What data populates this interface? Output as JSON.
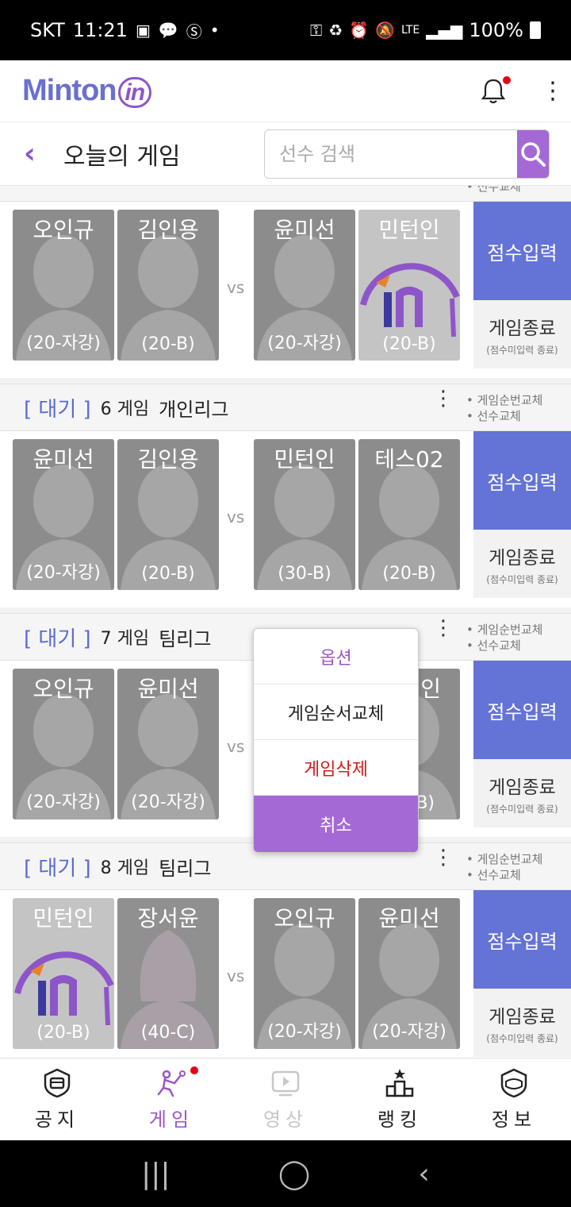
{
  "status_bar": {
    "carrier": "SKT",
    "time": "11:21",
    "network": "LTE",
    "battery": "100%"
  },
  "app": {
    "logo_main": "Minton",
    "logo_in": "in"
  },
  "header": {
    "title": "오늘의 게임",
    "search_placeholder": "선수 검색"
  },
  "games": [
    {
      "status": "",
      "number": "",
      "league": "",
      "notes": [
        "선수교체"
      ],
      "players": [
        {
          "name": "오인규",
          "grade": "(20-자강)",
          "avatar": "male"
        },
        {
          "name": "김인용",
          "grade": "(20-B)",
          "avatar": "male"
        },
        {
          "name": "윤미선",
          "grade": "(20-자강)",
          "avatar": "male"
        },
        {
          "name": "민턴인",
          "grade": "(20-B)",
          "avatar": "logo"
        }
      ]
    },
    {
      "status": "[ 대기 ]",
      "number": "6 게임",
      "league": "개인리그",
      "notes": [
        "게임순번교체",
        "선수교체"
      ],
      "players": [
        {
          "name": "윤미선",
          "grade": "(20-자강)",
          "avatar": "male"
        },
        {
          "name": "김인용",
          "grade": "(20-B)",
          "avatar": "male"
        },
        {
          "name": "민턴인",
          "grade": "(30-B)",
          "avatar": "male"
        },
        {
          "name": "테스02",
          "grade": "(20-B)",
          "avatar": "male"
        }
      ]
    },
    {
      "status": "[ 대기 ]",
      "number": "7 게임",
      "league": "팀리그",
      "notes": [
        "게임순번교체",
        "선수교체"
      ],
      "players": [
        {
          "name": "오인규",
          "grade": "(20-자강)",
          "avatar": "male"
        },
        {
          "name": "윤미선",
          "grade": "(20-자강)",
          "avatar": "male"
        },
        {
          "name": "",
          "grade": "",
          "avatar": "male"
        },
        {
          "name": "인",
          "grade": "B)",
          "avatar": "male"
        }
      ]
    },
    {
      "status": "[ 대기 ]",
      "number": "8 게임",
      "league": "팀리그",
      "notes": [
        "게임순번교체",
        "선수교체"
      ],
      "players": [
        {
          "name": "민턴인",
          "grade": "(20-B)",
          "avatar": "logo"
        },
        {
          "name": "장서윤",
          "grade": "(40-C)",
          "avatar": "female"
        },
        {
          "name": "오인규",
          "grade": "(20-자강)",
          "avatar": "male"
        },
        {
          "name": "윤미선",
          "grade": "(20-자강)",
          "avatar": "male"
        }
      ]
    }
  ],
  "game_labels": {
    "vs": "vs",
    "score_input": "점수입력",
    "end_game": "게임종료",
    "end_game_note": "(점수미입력 종료)"
  },
  "popup": {
    "title": "옵션",
    "reorder": "게임순서교체",
    "delete": "게임삭제",
    "cancel": "취소"
  },
  "bottom_nav": [
    {
      "label": "공지",
      "icon": "notice-icon"
    },
    {
      "label": "게임",
      "icon": "badminton-icon"
    },
    {
      "label": "영상",
      "icon": "video-icon"
    },
    {
      "label": "랭킹",
      "icon": "ranking-icon"
    },
    {
      "label": "정보",
      "icon": "info-icon"
    }
  ],
  "colors": {
    "accent_purple": "#a569d6",
    "accent_blue": "#6473d6",
    "status_blue": "#5a6ad6",
    "danger_red": "#d81b1b"
  }
}
